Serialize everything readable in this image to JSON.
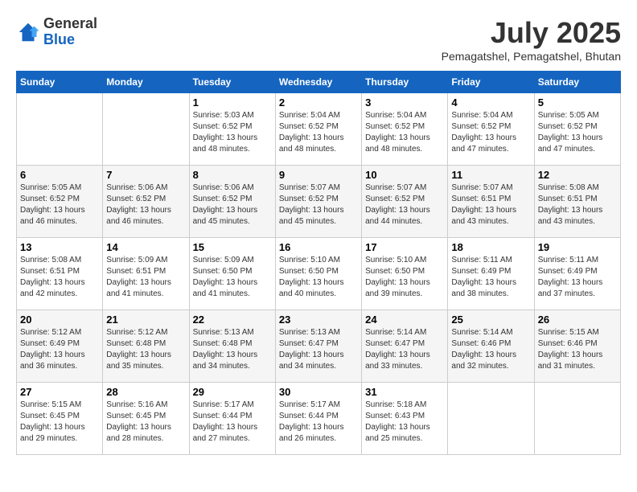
{
  "logo": {
    "general": "General",
    "blue": "Blue"
  },
  "title": {
    "month_year": "July 2025",
    "location": "Pemagatshel, Pemagatshel, Bhutan"
  },
  "weekdays": [
    "Sunday",
    "Monday",
    "Tuesday",
    "Wednesday",
    "Thursday",
    "Friday",
    "Saturday"
  ],
  "weeks": [
    [
      {
        "day": "",
        "info": ""
      },
      {
        "day": "",
        "info": ""
      },
      {
        "day": "1",
        "info": "Sunrise: 5:03 AM\nSunset: 6:52 PM\nDaylight: 13 hours and 48 minutes."
      },
      {
        "day": "2",
        "info": "Sunrise: 5:04 AM\nSunset: 6:52 PM\nDaylight: 13 hours and 48 minutes."
      },
      {
        "day": "3",
        "info": "Sunrise: 5:04 AM\nSunset: 6:52 PM\nDaylight: 13 hours and 48 minutes."
      },
      {
        "day": "4",
        "info": "Sunrise: 5:04 AM\nSunset: 6:52 PM\nDaylight: 13 hours and 47 minutes."
      },
      {
        "day": "5",
        "info": "Sunrise: 5:05 AM\nSunset: 6:52 PM\nDaylight: 13 hours and 47 minutes."
      }
    ],
    [
      {
        "day": "6",
        "info": "Sunrise: 5:05 AM\nSunset: 6:52 PM\nDaylight: 13 hours and 46 minutes."
      },
      {
        "day": "7",
        "info": "Sunrise: 5:06 AM\nSunset: 6:52 PM\nDaylight: 13 hours and 46 minutes."
      },
      {
        "day": "8",
        "info": "Sunrise: 5:06 AM\nSunset: 6:52 PM\nDaylight: 13 hours and 45 minutes."
      },
      {
        "day": "9",
        "info": "Sunrise: 5:07 AM\nSunset: 6:52 PM\nDaylight: 13 hours and 45 minutes."
      },
      {
        "day": "10",
        "info": "Sunrise: 5:07 AM\nSunset: 6:52 PM\nDaylight: 13 hours and 44 minutes."
      },
      {
        "day": "11",
        "info": "Sunrise: 5:07 AM\nSunset: 6:51 PM\nDaylight: 13 hours and 43 minutes."
      },
      {
        "day": "12",
        "info": "Sunrise: 5:08 AM\nSunset: 6:51 PM\nDaylight: 13 hours and 43 minutes."
      }
    ],
    [
      {
        "day": "13",
        "info": "Sunrise: 5:08 AM\nSunset: 6:51 PM\nDaylight: 13 hours and 42 minutes."
      },
      {
        "day": "14",
        "info": "Sunrise: 5:09 AM\nSunset: 6:51 PM\nDaylight: 13 hours and 41 minutes."
      },
      {
        "day": "15",
        "info": "Sunrise: 5:09 AM\nSunset: 6:50 PM\nDaylight: 13 hours and 41 minutes."
      },
      {
        "day": "16",
        "info": "Sunrise: 5:10 AM\nSunset: 6:50 PM\nDaylight: 13 hours and 40 minutes."
      },
      {
        "day": "17",
        "info": "Sunrise: 5:10 AM\nSunset: 6:50 PM\nDaylight: 13 hours and 39 minutes."
      },
      {
        "day": "18",
        "info": "Sunrise: 5:11 AM\nSunset: 6:49 PM\nDaylight: 13 hours and 38 minutes."
      },
      {
        "day": "19",
        "info": "Sunrise: 5:11 AM\nSunset: 6:49 PM\nDaylight: 13 hours and 37 minutes."
      }
    ],
    [
      {
        "day": "20",
        "info": "Sunrise: 5:12 AM\nSunset: 6:49 PM\nDaylight: 13 hours and 36 minutes."
      },
      {
        "day": "21",
        "info": "Sunrise: 5:12 AM\nSunset: 6:48 PM\nDaylight: 13 hours and 35 minutes."
      },
      {
        "day": "22",
        "info": "Sunrise: 5:13 AM\nSunset: 6:48 PM\nDaylight: 13 hours and 34 minutes."
      },
      {
        "day": "23",
        "info": "Sunrise: 5:13 AM\nSunset: 6:47 PM\nDaylight: 13 hours and 34 minutes."
      },
      {
        "day": "24",
        "info": "Sunrise: 5:14 AM\nSunset: 6:47 PM\nDaylight: 13 hours and 33 minutes."
      },
      {
        "day": "25",
        "info": "Sunrise: 5:14 AM\nSunset: 6:46 PM\nDaylight: 13 hours and 32 minutes."
      },
      {
        "day": "26",
        "info": "Sunrise: 5:15 AM\nSunset: 6:46 PM\nDaylight: 13 hours and 31 minutes."
      }
    ],
    [
      {
        "day": "27",
        "info": "Sunrise: 5:15 AM\nSunset: 6:45 PM\nDaylight: 13 hours and 29 minutes."
      },
      {
        "day": "28",
        "info": "Sunrise: 5:16 AM\nSunset: 6:45 PM\nDaylight: 13 hours and 28 minutes."
      },
      {
        "day": "29",
        "info": "Sunrise: 5:17 AM\nSunset: 6:44 PM\nDaylight: 13 hours and 27 minutes."
      },
      {
        "day": "30",
        "info": "Sunrise: 5:17 AM\nSunset: 6:44 PM\nDaylight: 13 hours and 26 minutes."
      },
      {
        "day": "31",
        "info": "Sunrise: 5:18 AM\nSunset: 6:43 PM\nDaylight: 13 hours and 25 minutes."
      },
      {
        "day": "",
        "info": ""
      },
      {
        "day": "",
        "info": ""
      }
    ]
  ]
}
